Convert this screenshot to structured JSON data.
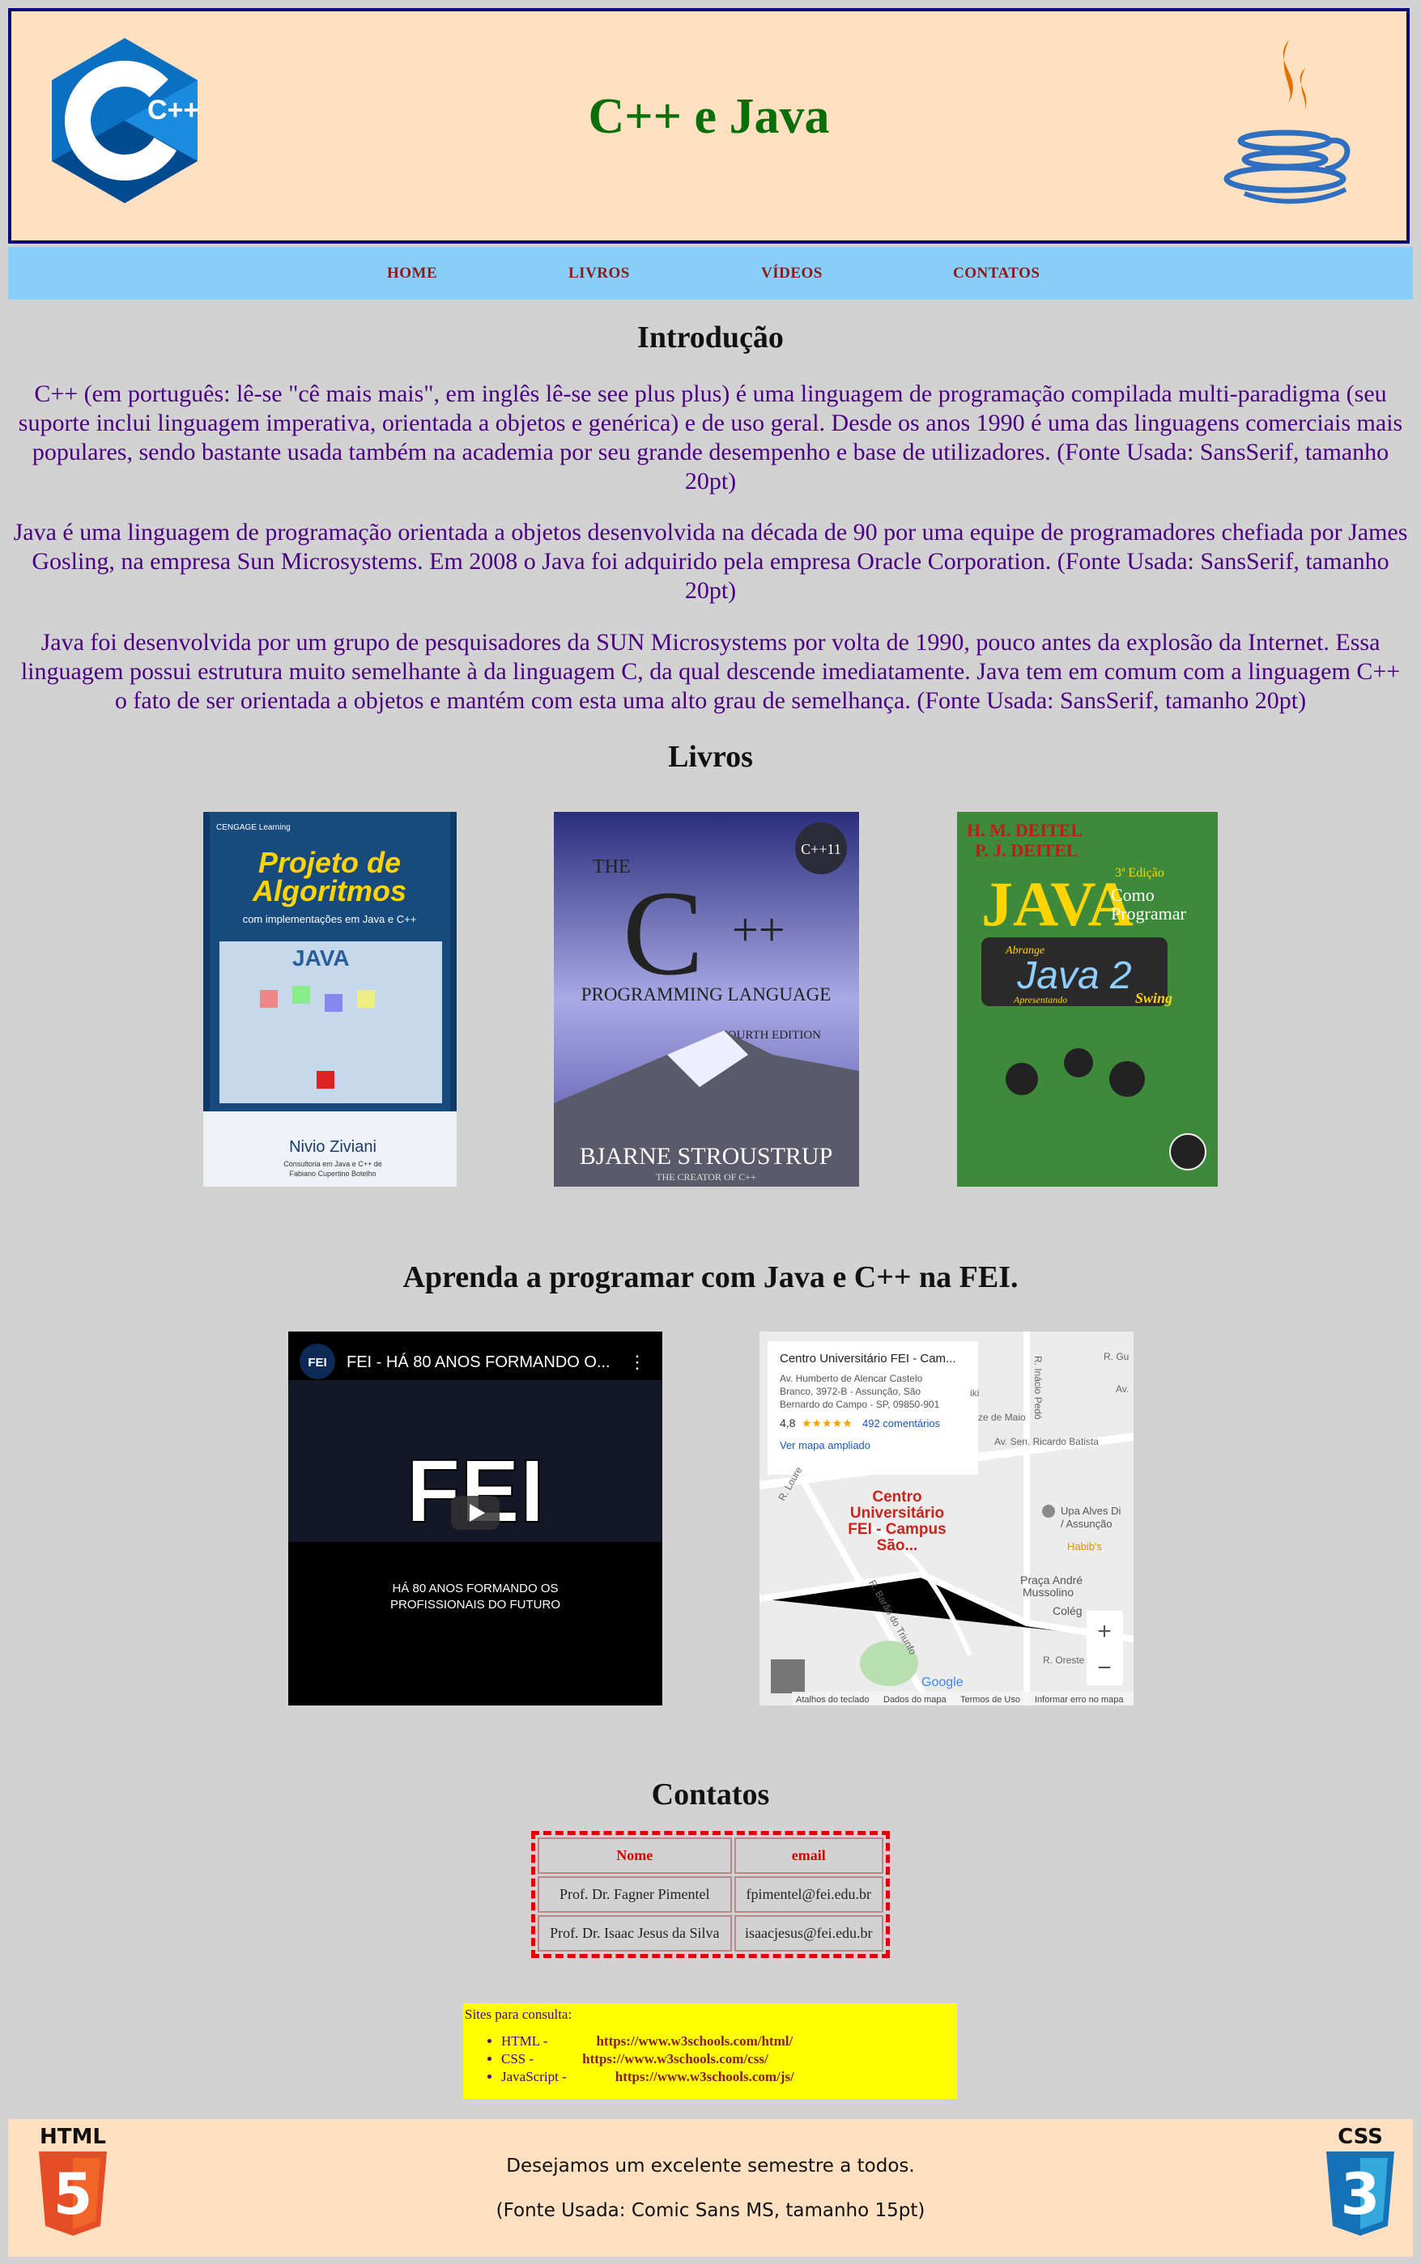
{
  "header": {
    "title": "C++ e Java",
    "cpp_logo_text": "C++",
    "colors": {
      "title": "#0a6e0a",
      "bg": "#ffe0c0",
      "border": "#0a0a7a"
    }
  },
  "nav": {
    "items": [
      "HOME",
      "LIVROS",
      "VÍDEOS",
      "CONTATOS"
    ]
  },
  "intro": {
    "heading": "Introdução",
    "paragraphs": [
      "C++ (em português: lê-se \"cê mais mais\", em inglês lê-se see plus plus) é uma linguagem de programação compilada multi-paradigma (seu suporte inclui linguagem imperativa, orientada a objetos e genérica) e de uso geral. Desde os anos 1990 é uma das linguagens comerciais mais populares, sendo bastante usada também na academia por seu grande desempenho e base de utilizadores. (Fonte Usada: SansSerif, tamanho 20pt)",
      "Java é uma linguagem de programação orientada a objetos desenvolvida na década de 90 por uma equipe de programadores chefiada por James Gosling, na empresa Sun Microsystems. Em 2008 o Java foi adquirido pela empresa Oracle Corporation. (Fonte Usada: SansSerif, tamanho 20pt)",
      "Java foi desenvolvida por um grupo de pesquisadores da SUN Microsystems por volta de 1990, pouco antes da explosão da Internet. Essa linguagem possui estrutura muito semelhante à da linguagem C, da qual descende imediatamente. Java tem em comum com a linguagem C++ o fato de ser orientada a objetos e mantém com esta uma alto grau de semelhança. (Fonte Usada: SansSerif, tamanho 20pt)"
    ]
  },
  "books": {
    "heading": "Livros",
    "items": [
      {
        "publisher": "CENGAGE Learning",
        "title1": "Projeto de",
        "title2": "Algoritmos",
        "subtitle": "com implementações em Java e C++",
        "tag": "JAVA",
        "author": "Nivio Ziviani",
        "coauthor1": "Consultoria em Java e C++ de",
        "coauthor2": "Fabiano Cupertino Botelho"
      },
      {
        "title_the": "THE",
        "title_c": "C",
        "title_pp": "++",
        "title_rest": "PROGRAMMING LANGUAGE",
        "edition": "FOURTH EDITION",
        "badge": "C++11",
        "author": "BJARNE STROUSTRUP",
        "author_sub": "THE CREATOR OF C++"
      },
      {
        "authors1": "H. M. DEITEL",
        "authors2": "P. J. DEITEL",
        "edition": "3ª Edição",
        "title": "JAVA",
        "subtitle1": "Como",
        "subtitle2": "Programar",
        "abrange": "Abrange",
        "java2": "Java 2",
        "apresentando": "Apresentando",
        "swing": "Swing"
      }
    ]
  },
  "learn": {
    "heading": "Aprenda a programar com Java e C++ na FEI.",
    "video": {
      "title": "FEI - HÁ 80 ANOS FORMANDO O...",
      "channel": "FEI",
      "logo": "FEI",
      "line1": "HÁ 80 ANOS FORMANDO OS",
      "line2": "PROFISSIONAIS DO FUTURO"
    },
    "map": {
      "place": "Centro Universitário FEI - Cam...",
      "address1": "Av. Humberto de Alencar Castelo",
      "address2": "Branco, 3972-B - Assunção, São",
      "address3": "Bernardo do Campo - SP, 09850-901",
      "rating": "4,8",
      "stars": "★★★★★",
      "reviews": "492 comentários",
      "link": "Ver mapa ampliado",
      "label1": "Centro",
      "label2": "Universitário",
      "label3": "FEI - Campus",
      "label4": "São...",
      "streets": [
        "R. Inácio Pedó",
        "R. Gu",
        "Av.",
        "ze de Maio",
        "Av. Sen. Ricardo Batista",
        "Upa Alves Di",
        "/ Assunção",
        "Habib's",
        "Praça André",
        "Mussolino",
        "Colég",
        "R. Oreste",
        "R. Barão do Triunfo",
        "R. Loure",
        "iki"
      ],
      "brand": "Google",
      "footer": [
        "Atalhos do teclado",
        "Dados do mapa",
        "Termos de Uso",
        "Informar erro no mapa"
      ]
    }
  },
  "contacts": {
    "heading": "Contatos",
    "columns": [
      "Nome",
      "email"
    ],
    "rows": [
      [
        "Prof. Dr. Fagner Pimentel",
        "fpimentel@fei.edu.br"
      ],
      [
        "Prof. Dr. Isaac Jesus da Silva",
        "isaacjesus@fei.edu.br"
      ]
    ]
  },
  "refs": {
    "title": "Sites para consulta:",
    "items": [
      {
        "label": "HTML -",
        "url": "https://www.w3schools.com/html/"
      },
      {
        "label": "CSS -",
        "url": "https://www.w3schools.com/css/"
      },
      {
        "label": "JavaScript -",
        "url": "https://www.w3schools.com/js/"
      }
    ]
  },
  "footer": {
    "line1": "Desejamos um excelente semestre a todos.",
    "line2": "(Fonte Usada: Comic Sans MS, tamanho 15pt)",
    "html_badge": "HTML",
    "html_num": "5",
    "css_badge": "CSS",
    "css_num": "3"
  }
}
